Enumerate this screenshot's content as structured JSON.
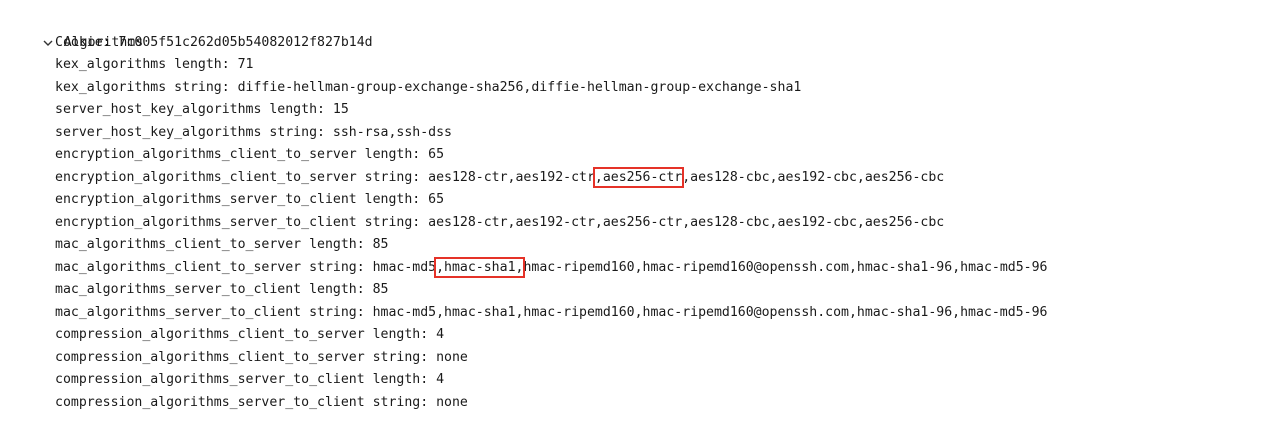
{
  "section": {
    "title": "Algorithms",
    "toggle_icon": "chevron-down-icon",
    "highlight_color": "#e53228"
  },
  "fields": [
    {
      "text": "Cookie: 7c005f51c262d05b54082012f827b14d"
    },
    {
      "text": "kex_algorithms length: 71"
    },
    {
      "text": "kex_algorithms string: diffie-hellman-group-exchange-sha256,diffie-hellman-group-exchange-sha1"
    },
    {
      "text": "server_host_key_algorithms length: 15"
    },
    {
      "text": "server_host_key_algorithms string: ssh-rsa,ssh-dss"
    },
    {
      "text": "encryption_algorithms_client_to_server length: 65"
    },
    {
      "before": "encryption_algorithms_client_to_server string: aes128-ctr,aes192-ctr",
      "highlight": ",aes256-ctr",
      "after": ",aes128-cbc,aes192-cbc,aes256-cbc"
    },
    {
      "text": "encryption_algorithms_server_to_client length: 65"
    },
    {
      "text": "encryption_algorithms_server_to_client string: aes128-ctr,aes192-ctr,aes256-ctr,aes128-cbc,aes192-cbc,aes256-cbc"
    },
    {
      "text": "mac_algorithms_client_to_server length: 85"
    },
    {
      "before": "mac_algorithms_client_to_server string: hmac-md5",
      "highlight": ",hmac-sha1,",
      "after": "hmac-ripemd160,hmac-ripemd160@openssh.com,hmac-sha1-96,hmac-md5-96"
    },
    {
      "text": "mac_algorithms_server_to_client length: 85"
    },
    {
      "text": "mac_algorithms_server_to_client string: hmac-md5,hmac-sha1,hmac-ripemd160,hmac-ripemd160@openssh.com,hmac-sha1-96,hmac-md5-96"
    },
    {
      "text": "compression_algorithms_client_to_server length: 4"
    },
    {
      "text": "compression_algorithms_client_to_server string: none"
    },
    {
      "text": "compression_algorithms_server_to_client length: 4"
    },
    {
      "text": "compression_algorithms_server_to_client string: none"
    }
  ]
}
